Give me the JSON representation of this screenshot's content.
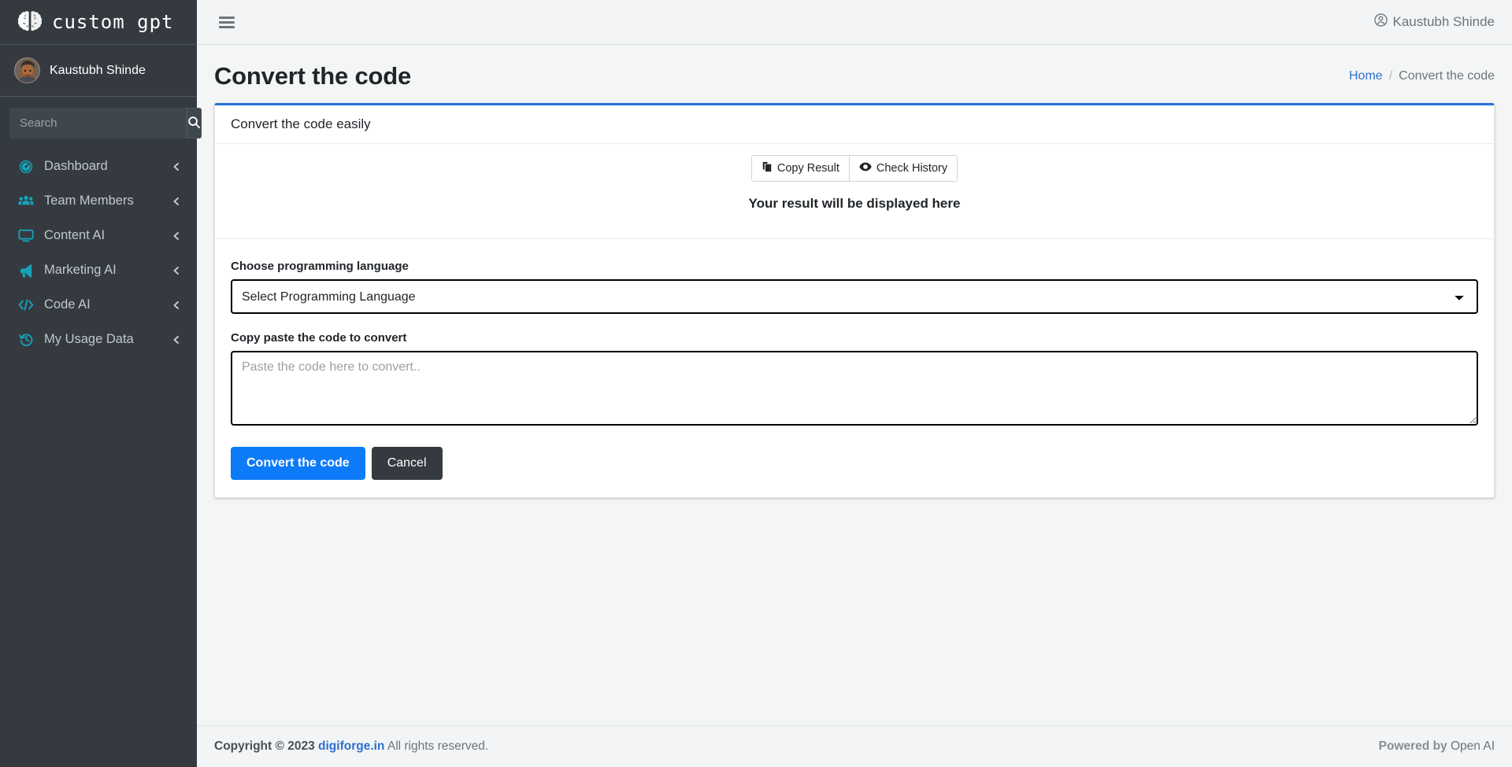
{
  "sidebar": {
    "brand": {
      "text": "custom gpt",
      "logo_icon": "brain-icon"
    },
    "user": {
      "name": "Kaustubh Shinde",
      "avatar_icon": "avatar"
    },
    "search": {
      "placeholder": "Search",
      "value": "",
      "button_icon": "search-icon"
    },
    "items": [
      {
        "label": "Dashboard",
        "icon": "dashboard-gauge-icon",
        "arrow": "chevron-left-icon"
      },
      {
        "label": "Team Members",
        "icon": "users-icon",
        "arrow": "chevron-left-icon"
      },
      {
        "label": "Content AI",
        "icon": "desktop-icon",
        "arrow": "chevron-left-icon"
      },
      {
        "label": "Marketing AI",
        "icon": "bullhorn-icon",
        "arrow": "chevron-left-icon"
      },
      {
        "label": "Code AI",
        "icon": "code-icon",
        "arrow": "chevron-left-icon"
      },
      {
        "label": "My Usage Data",
        "icon": "history-icon",
        "arrow": "chevron-left-icon"
      }
    ]
  },
  "topbar": {
    "menu_icon": "hamburger-icon",
    "user_icon": "user-circle-icon",
    "user_name": "Kaustubh Shinde"
  },
  "page": {
    "title": "Convert the code",
    "breadcrumb": {
      "home": "Home",
      "separator": "/",
      "current": "Convert the code"
    }
  },
  "card": {
    "header": "Convert the code easily",
    "toolbar": {
      "copy_label": "Copy Result",
      "copy_icon": "copy-icon",
      "history_label": "Check History",
      "history_icon": "eye-icon"
    },
    "result_placeholder": "Your result will be displayed here",
    "form": {
      "language_label": "Choose programming language",
      "language_selected": "Select Programming Language",
      "language_options": [
        "Select Programming Language"
      ],
      "code_label": "Copy paste the code to convert",
      "code_placeholder": "Paste the code here to convert..",
      "code_value": "",
      "submit_label": "Convert the code",
      "cancel_label": "Cancel"
    }
  },
  "footer": {
    "copyright_prefix": "Copyright © 2023",
    "site_link": "digiforge.in",
    "copyright_suffix": "All rights reserved.",
    "powered_prefix": "Powered by",
    "powered_name": "Open AI"
  },
  "colors": {
    "sidebar_bg": "#343a40",
    "accent_cyan": "#17a2b8",
    "primary_blue": "#0d7bf7",
    "card_top_border": "#2274d6",
    "link_blue": "#2f6fd0"
  }
}
